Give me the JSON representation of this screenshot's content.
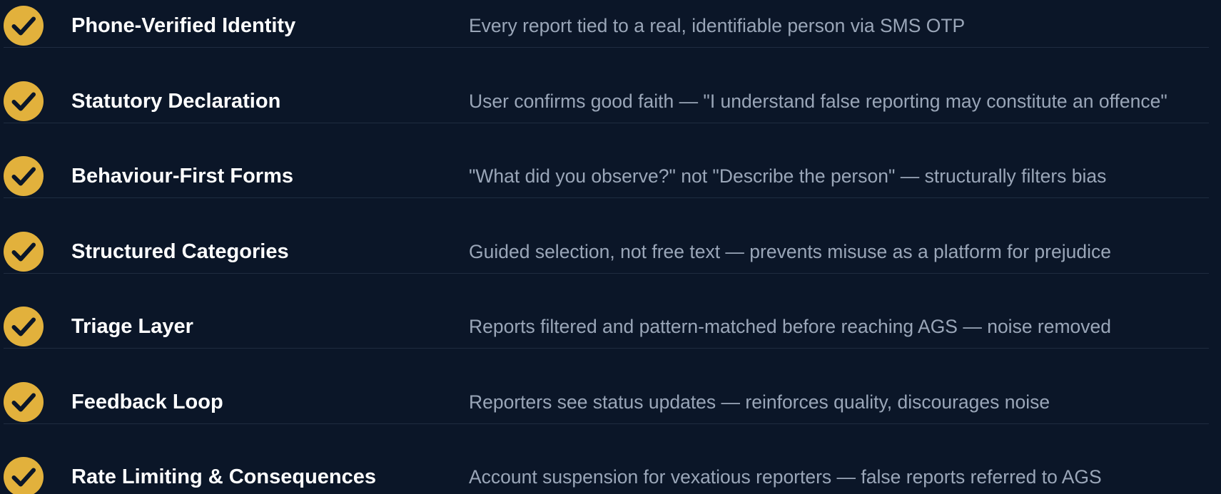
{
  "colors": {
    "background": "#0b1628",
    "check_badge": "#e2b13c",
    "check_mark": "#0b1628",
    "title_text": "#ffffff",
    "description_text": "#9aa6b8",
    "divider": "#1f2c40"
  },
  "icon": "check-circle-icon",
  "items": [
    {
      "title": "Phone-Verified Identity",
      "description": "Every report tied to a real, identifiable person via SMS OTP"
    },
    {
      "title": "Statutory Declaration",
      "description": "User confirms good faith — \"I understand false reporting may constitute an offence\""
    },
    {
      "title": "Behaviour-First Forms",
      "description": "\"What did you observe?\" not \"Describe the person\" — structurally filters bias"
    },
    {
      "title": "Structured Categories",
      "description": "Guided selection, not free text — prevents misuse as a platform for prejudice"
    },
    {
      "title": "Triage Layer",
      "description": "Reports filtered and pattern-matched before reaching AGS — noise removed"
    },
    {
      "title": "Feedback Loop",
      "description": "Reporters see status updates — reinforces quality, discourages noise"
    },
    {
      "title": "Rate Limiting & Consequences",
      "description": "Account suspension for vexatious reporters — false reports referred to AGS"
    }
  ]
}
